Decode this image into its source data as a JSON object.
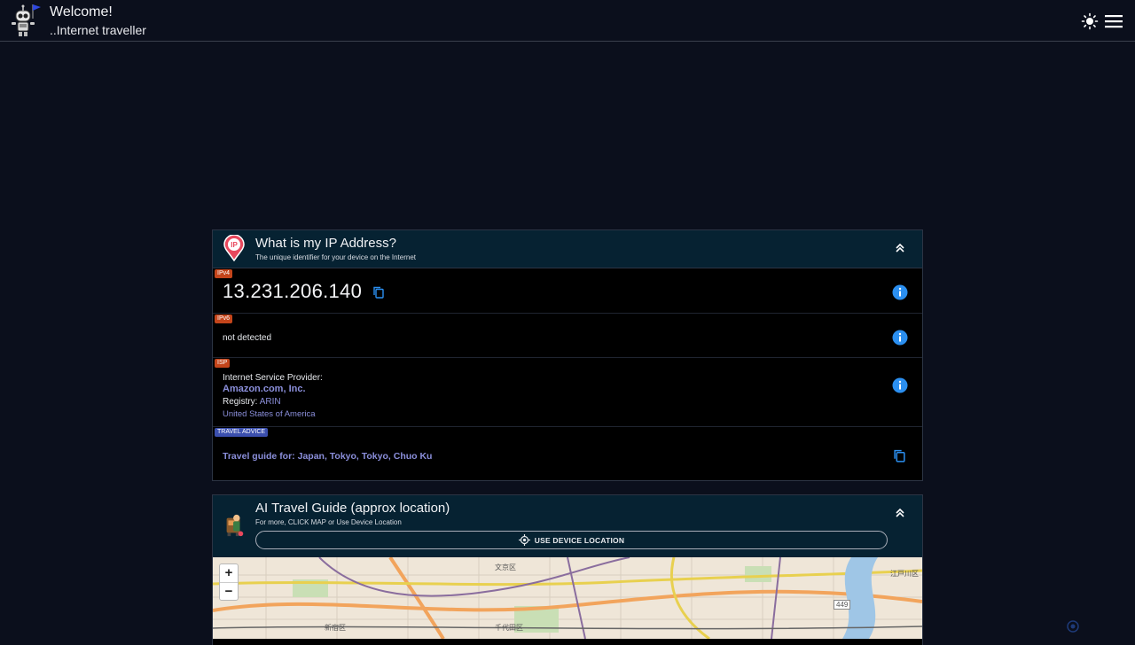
{
  "header": {
    "title": "Welcome!",
    "subtitle": "..Internet traveller",
    "icons": {
      "logo": "robot-logo-icon",
      "theme": "sun-icon",
      "menu": "hamburger-menu-icon"
    }
  },
  "ip_card": {
    "title": "What is my IP Address?",
    "subtitle": "The unique identifier for your device on the Internet",
    "ipv4": {
      "tag": "IPv4",
      "value": "13.231.206.140"
    },
    "ipv6": {
      "tag": "IPv6",
      "value": "not detected"
    },
    "isp": {
      "tag": "ISP",
      "label": "Internet Service Provider:",
      "name": "Amazon.com, Inc.",
      "registry_label": "Registry:",
      "registry": "ARIN",
      "country": "United States of America"
    },
    "travel": {
      "tag": "TRAVEL ADVICE",
      "text": "Travel guide for: Japan, Tokyo, Tokyo, Chuo Ku"
    }
  },
  "guide_card": {
    "title": "AI Travel Guide (approx location)",
    "subtitle": "For more, CLICK MAP or Use Device Location",
    "button": "USE DEVICE LOCATION",
    "map": {
      "zoom_in": "+",
      "zoom_out": "−",
      "labels": [
        "文京区",
        "新宿区",
        "千代田区",
        "江戸川区",
        "449"
      ]
    }
  },
  "colors": {
    "background": "#0b0f1c",
    "card_header": "#062232",
    "tag_orange": "#c4451b",
    "tag_blue": "#3b4fae",
    "info_blue": "#2b8ff0",
    "link": "#8b8fdb"
  }
}
